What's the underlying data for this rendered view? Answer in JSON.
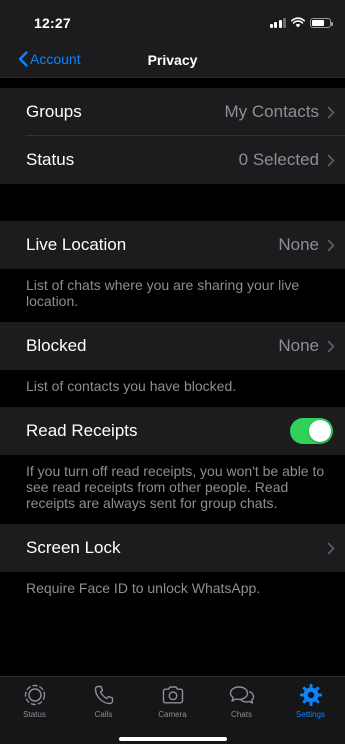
{
  "status_bar": {
    "time": "12:27"
  },
  "nav": {
    "back_label": "Account",
    "title": "Privacy"
  },
  "rows": {
    "groups": {
      "label": "Groups",
      "value": "My Contacts"
    },
    "status": {
      "label": "Status",
      "value": "0 Selected"
    },
    "live_location": {
      "label": "Live Location",
      "value": "None",
      "footer": "List of chats where you are sharing your live location."
    },
    "blocked": {
      "label": "Blocked",
      "value": "None",
      "footer": "List of contacts you have blocked."
    },
    "read_receipts": {
      "label": "Read Receipts",
      "enabled": true,
      "footer": "If you turn off read receipts, you won't be able to see read receipts from other people. Read receipts are always sent for group chats."
    },
    "screen_lock": {
      "label": "Screen Lock",
      "footer": "Require Face ID to unlock WhatsApp."
    }
  },
  "tabbar": {
    "tabs": [
      {
        "label": "Status",
        "icon": "status-icon",
        "active": false
      },
      {
        "label": "Calls",
        "icon": "phone-icon",
        "active": false
      },
      {
        "label": "Camera",
        "icon": "camera-icon",
        "active": false
      },
      {
        "label": "Chats",
        "icon": "chat-bubbles-icon",
        "active": false
      },
      {
        "label": "Settings",
        "icon": "gear-icon",
        "active": true
      }
    ]
  },
  "colors": {
    "accent": "#0a84ff",
    "toggle_on": "#30d158",
    "cell_bg": "#1c1c1e",
    "secondary_text": "#8e8e93"
  }
}
